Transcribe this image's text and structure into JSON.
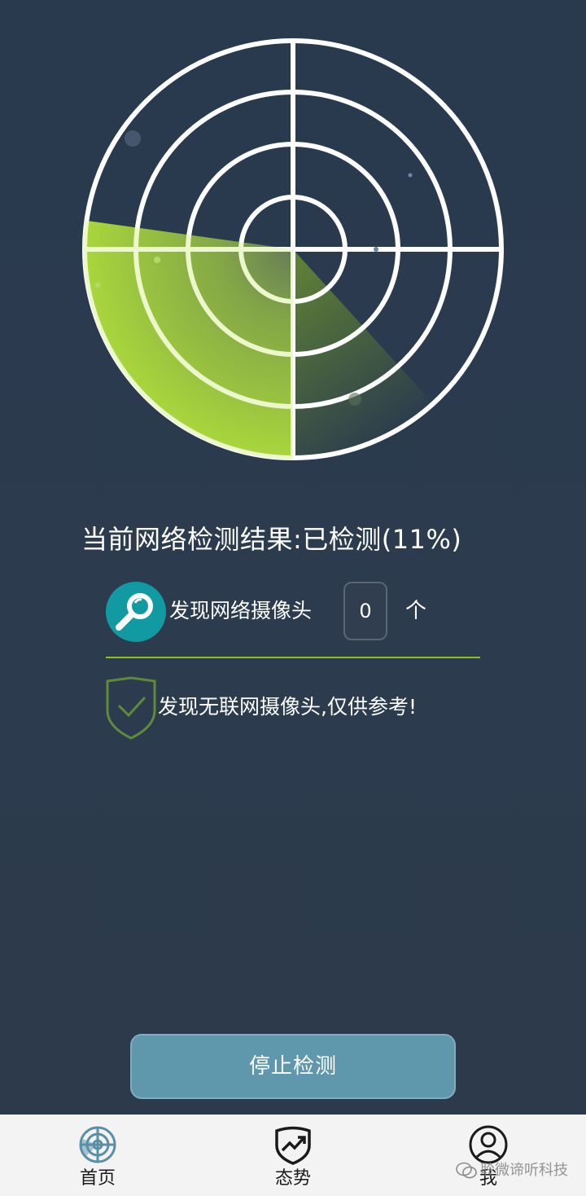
{
  "scan": {
    "status_label": "当前网络检测结果:已检测(11%)",
    "progress_percent": 11
  },
  "camera": {
    "label": "发现网络摄像头",
    "count": "0",
    "unit": "个"
  },
  "notice": {
    "text": "发现无联网摄像头,仅供参考!"
  },
  "actions": {
    "stop_label": "停止检测"
  },
  "nav": {
    "items": [
      {
        "label": "首页",
        "icon": "radar-icon",
        "active": true
      },
      {
        "label": "态势",
        "icon": "trend-shield-icon",
        "active": false
      },
      {
        "label": "我",
        "icon": "user-icon",
        "active": false
      }
    ]
  },
  "watermark": {
    "text": "聆微谛听科技"
  },
  "colors": {
    "background": "#2b3a4d",
    "accent_green": "#8ec11e",
    "badge_teal": "#129aa3",
    "button_blue": "#5f97ac",
    "nav_bg": "#f3f3f3"
  }
}
